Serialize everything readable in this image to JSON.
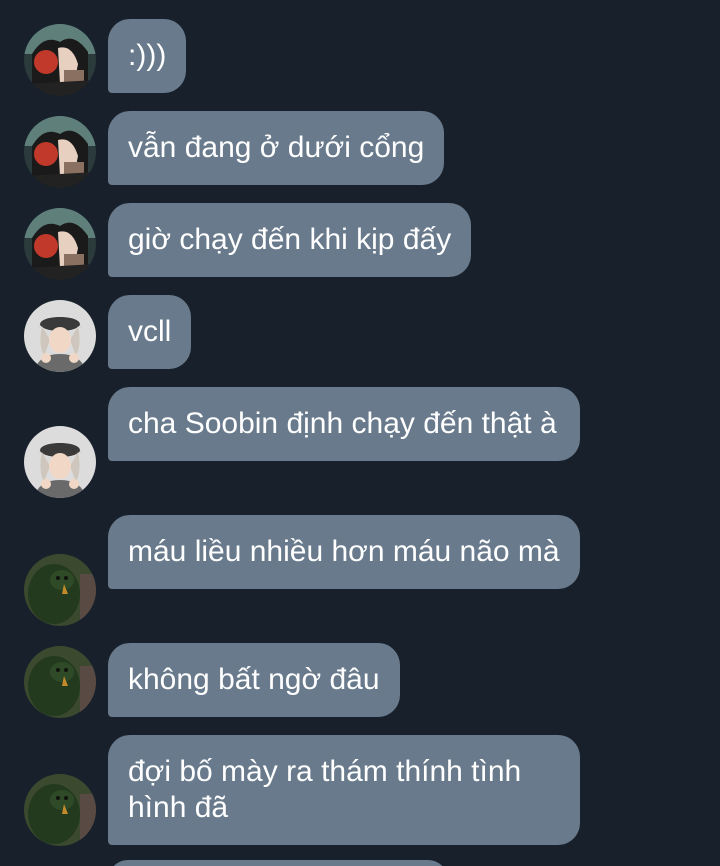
{
  "messages": [
    {
      "text": ":)))",
      "avatar": "avatar-anime-1"
    },
    {
      "text": "vẫn đang ở dưới cổng",
      "avatar": "avatar-anime-1"
    },
    {
      "text": "giờ chạy đến khi kịp đấy",
      "avatar": "avatar-anime-1"
    },
    {
      "text": "vcll",
      "avatar": "avatar-cap-2"
    },
    {
      "text": "cha Soobin định chạy đến thật à",
      "avatar": "avatar-cap-2"
    },
    {
      "text": "máu liều nhiều hơn máu não mà",
      "avatar": "avatar-green-3"
    },
    {
      "text": "không bất ngờ đâu",
      "avatar": "avatar-green-3"
    },
    {
      "text": "đợi bố mày ra thám thính tình hình đã",
      "avatar": "avatar-green-3"
    }
  ],
  "colors": {
    "background": "#18202b",
    "bubble": "#687a8c",
    "text": "#ffffff"
  }
}
